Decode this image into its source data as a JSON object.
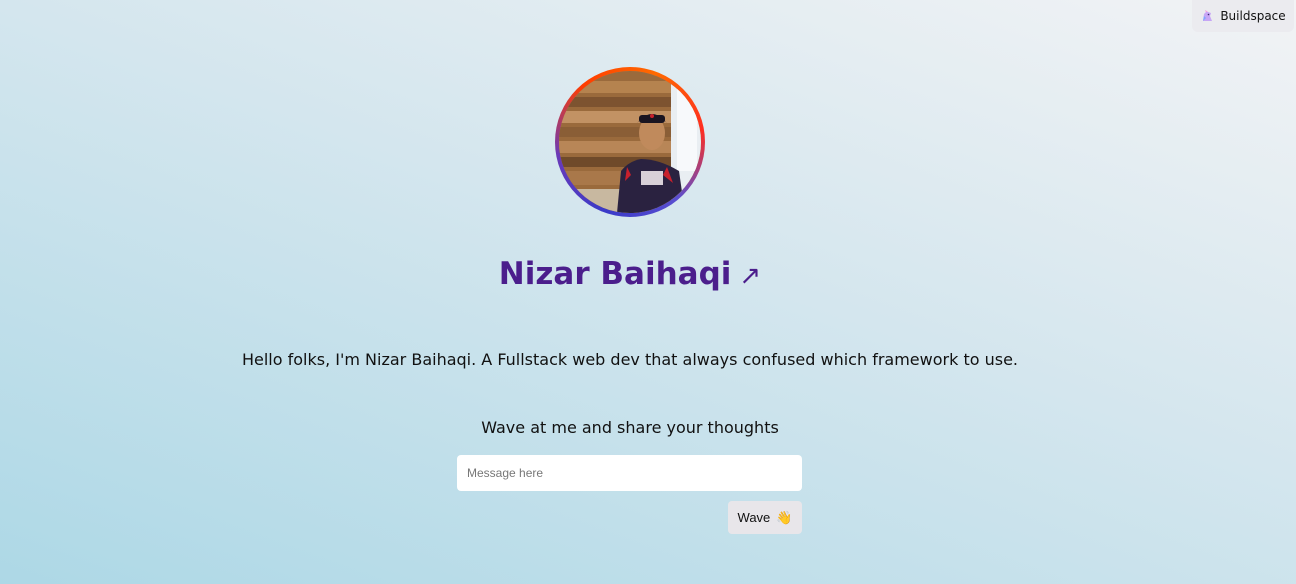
{
  "header": {
    "buildspace_label": "Buildspace",
    "buildspace_icon": "unicorn-icon"
  },
  "profile": {
    "name": "Nizar Baihaqi",
    "link_icon": "↗",
    "bio": "Hello folks, I'm Nizar Baihaqi. A Fullstack web dev that always confused which framework to use."
  },
  "wave_form": {
    "prompt": "Wave at me and share your thoughts",
    "message_placeholder": "Message here",
    "message_value": "",
    "wave_label": "Wave",
    "wave_emoji": "👋"
  },
  "colors": {
    "name_color": "#4b1e8c",
    "bg_start": "#add8e6",
    "bg_end": "#f2f3f5"
  }
}
